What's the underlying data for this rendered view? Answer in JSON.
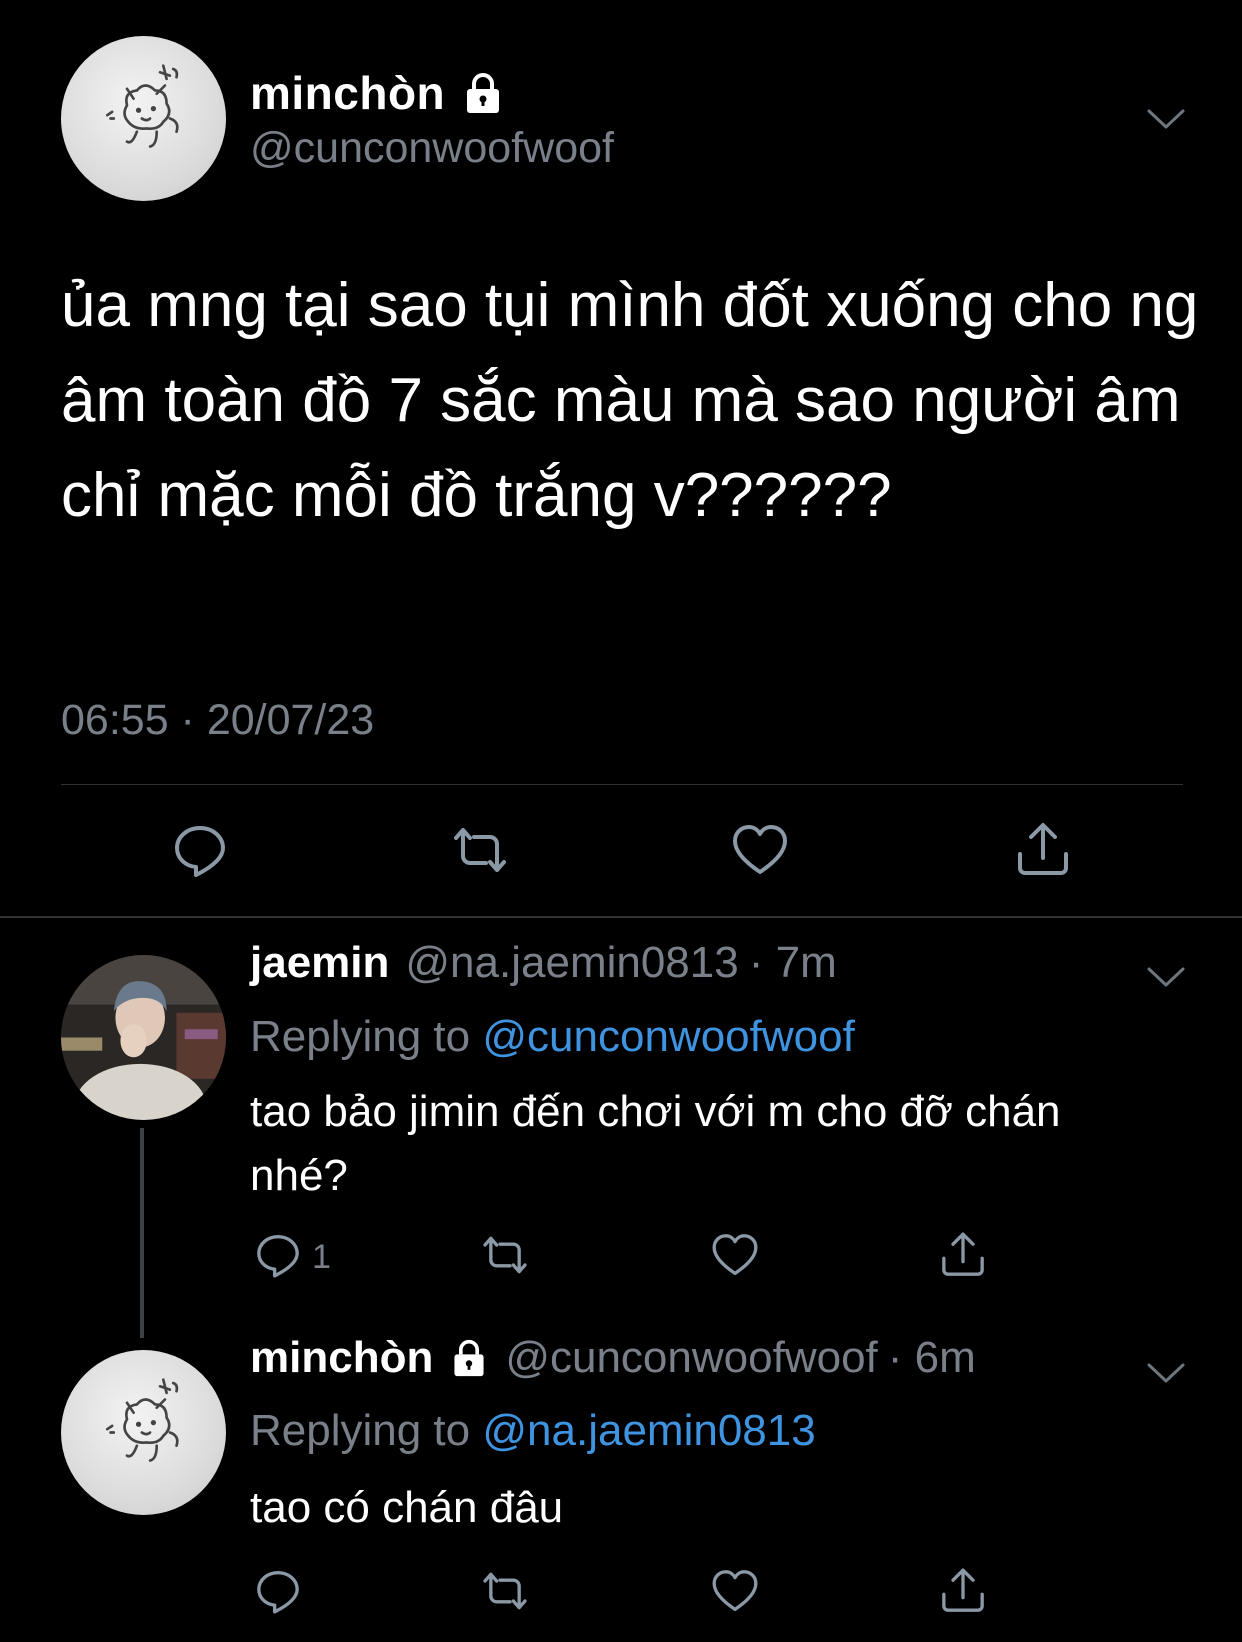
{
  "main_tweet": {
    "display_name": "minchòn",
    "handle": "@cunconwoofwoof",
    "text": "ủa mng tại sao tụi mình đốt xuống cho ng âm toàn đồ 7 sắc màu mà sao người âm chỉ mặc mỗi đồ trắng v??????",
    "timestamp": "06:55 · 20/07/23",
    "icons": [
      "reply-icon",
      "retweet-icon",
      "like-icon",
      "share-icon"
    ]
  },
  "replies": [
    {
      "display_name": "jaemin",
      "handle": "@na.jaemin0813",
      "time": "· 7m",
      "replying_label": "Replying to",
      "replying_to": "@cunconwoofwoof",
      "text": "tao bảo jimin đến chơi với m cho đỡ chán nhé?",
      "reply_count": "1"
    },
    {
      "display_name": "minchòn",
      "handle": "@cunconwoofwoof",
      "time": "· 6m",
      "replying_label": "Replying to",
      "replying_to": "@na.jaemin0813",
      "text": "tao có chán đâu",
      "reply_count": ""
    }
  ],
  "colors": {
    "background": "#000000",
    "text_primary": "#ffffff",
    "text_secondary": "#7a8089",
    "link": "#3e94e0",
    "divider": "#2f3336"
  }
}
